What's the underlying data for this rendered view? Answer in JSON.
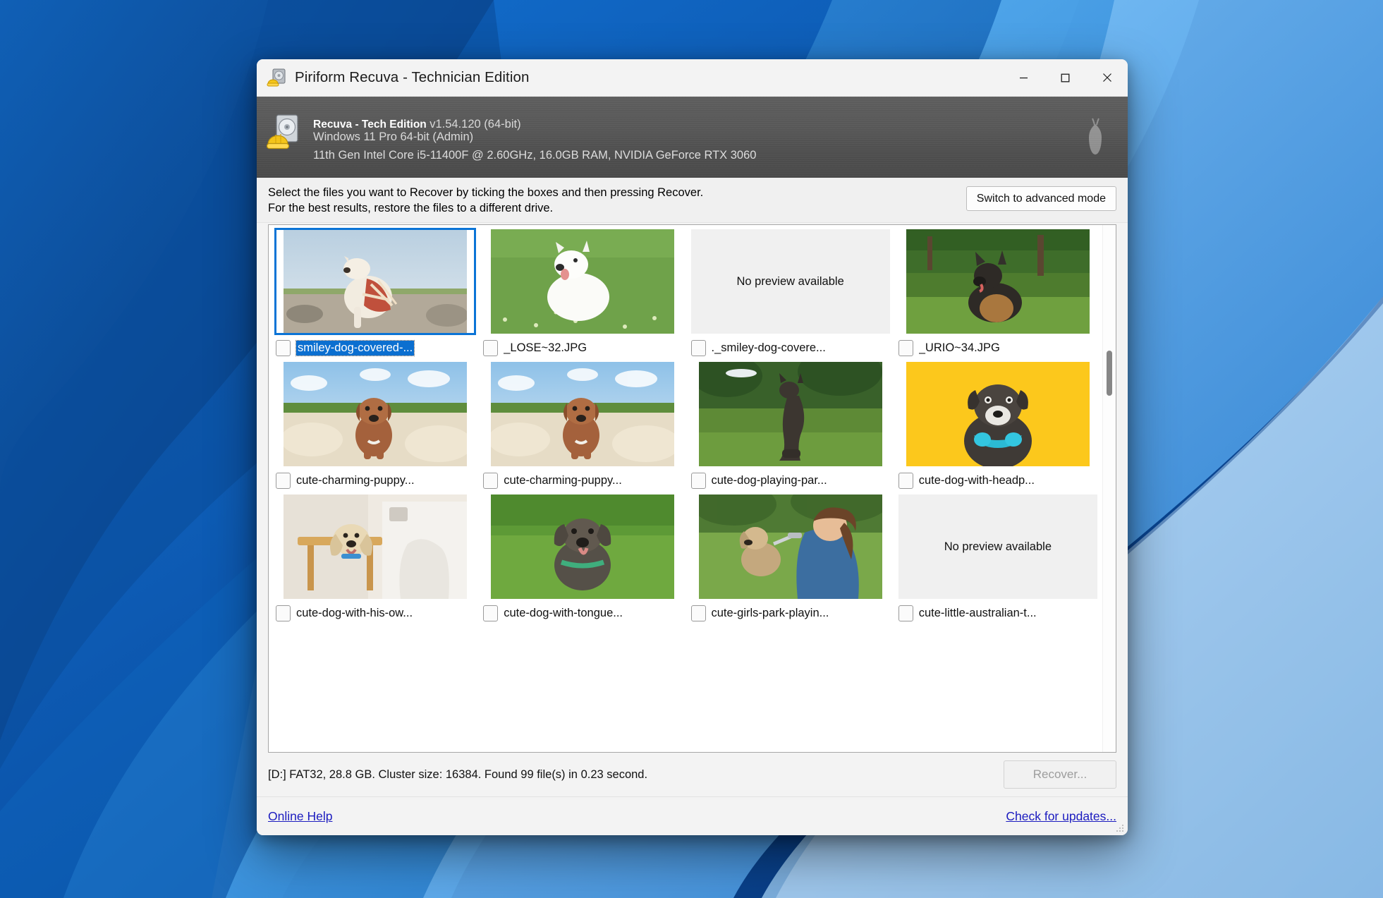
{
  "window": {
    "title": "Piriform Recuva - Technician Edition",
    "icon": "recuva-drive-hardhat-icon",
    "controls": {
      "minimize": "minimize-icon",
      "maximize": "maximize-icon",
      "close": "close-icon"
    }
  },
  "banner": {
    "product": "Recuva - Tech Edition",
    "version": "v1.54.120 (64-bit)",
    "os": "Windows 11 Pro 64-bit (Admin)",
    "hardware": "11th Gen Intel Core i5-11400F @ 2.60GHz, 16.0GB RAM, NVIDIA GeForce RTX 3060",
    "watermark_icon": "piriform-pear-icon"
  },
  "instructions": {
    "text": "Select the files you want to Recover by ticking the boxes and then pressing Recover.\nFor the best results, restore the files to a different drive.",
    "advanced_button": "Switch to advanced mode"
  },
  "files": [
    {
      "name": "smiley-dog-covered-...",
      "preview": "dog-blanket-beach",
      "selected": true,
      "checked": false
    },
    {
      "name": "_LOSE~32.JPG",
      "preview": "white-dog-grass",
      "selected": false,
      "checked": false
    },
    {
      "name": "._smiley-dog-covere...",
      "preview": "none",
      "selected": false,
      "checked": false
    },
    {
      "name": "_URIO~34.JPG",
      "preview": "shepherd-grass",
      "selected": false,
      "checked": false
    },
    {
      "name": "cute-charming-puppy...",
      "preview": "brown-puppy-sand",
      "selected": false,
      "checked": false
    },
    {
      "name": "cute-charming-puppy...",
      "preview": "brown-puppy-sand",
      "selected": false,
      "checked": false
    },
    {
      "name": "cute-dog-playing-par...",
      "preview": "dog-catch-frisbee",
      "selected": false,
      "checked": false
    },
    {
      "name": "cute-dog-with-headp...",
      "preview": "dog-yellow-bg",
      "selected": false,
      "checked": false
    },
    {
      "name": "cute-dog-with-his-ow...",
      "preview": "dog-at-table",
      "selected": false,
      "checked": false
    },
    {
      "name": "cute-dog-with-tongue...",
      "preview": "fluffy-dog-lawn",
      "selected": false,
      "checked": false
    },
    {
      "name": "cute-girls-park-playin...",
      "preview": "girl-with-dog",
      "selected": false,
      "checked": false
    },
    {
      "name": "cute-little-australian-t...",
      "preview": "none",
      "selected": false,
      "checked": false
    }
  ],
  "no_preview_label": "No preview available",
  "status": {
    "text": "[D:] FAT32, 28.8 GB. Cluster size: 16384. Found 99 file(s) in 0.23 second.",
    "recover_button": "Recover..."
  },
  "footer": {
    "online_help": "Online Help",
    "check_updates": "Check for updates...",
    "resize_grip": "resize-grip-icon"
  },
  "colors": {
    "selection_blue": "#0b6fd0",
    "link_blue": "#1b1bbf",
    "banner_gray": "#555555",
    "window_bg": "#f3f3f3"
  }
}
